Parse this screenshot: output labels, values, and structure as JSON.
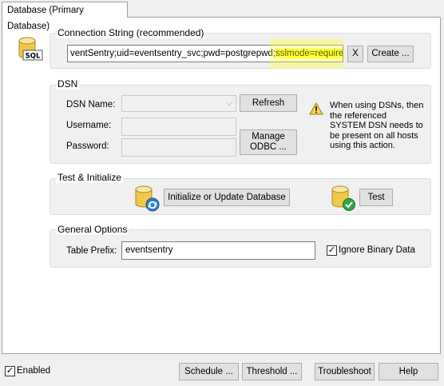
{
  "tab": {
    "label": "Database (Primary Database)"
  },
  "connection": {
    "title": "Connection String (recommended)",
    "value_main": "ventSentry;uid=eventsentry_svc;pwd=postgrepwd;",
    "value_highlight": "sslmode=require;",
    "clear_label": "X",
    "create_label": "Create ...",
    "icon_text": "SQL"
  },
  "dsn": {
    "title": "DSN",
    "name_label": "DSN Name:",
    "username_label": "Username:",
    "password_label": "Password:",
    "refresh_label": "Refresh",
    "manage_label_1": "Manage",
    "manage_label_2": "ODBC ...",
    "warning_text": "When using DSNs, then the referenced SYSTEM DSN needs to be present on all hosts using this action."
  },
  "test_init": {
    "title": "Test & Initialize",
    "initialize_label": "Initialize or Update Database",
    "test_label": "Test"
  },
  "general": {
    "title": "General Options",
    "prefix_label": "Table Prefix:",
    "prefix_value": "eventsentry",
    "ignore_binary_label": "Ignore Binary Data",
    "ignore_binary_checked": true
  },
  "footer": {
    "enabled_label": "Enabled",
    "enabled_checked": true,
    "schedule_label": "Schedule ...",
    "threshold_label": "Threshold ...",
    "troubleshoot_label": "Troubleshoot",
    "help_label": "Help"
  },
  "colors": {
    "highlight": "#ffff33",
    "group_border": "#d5dfe5"
  }
}
